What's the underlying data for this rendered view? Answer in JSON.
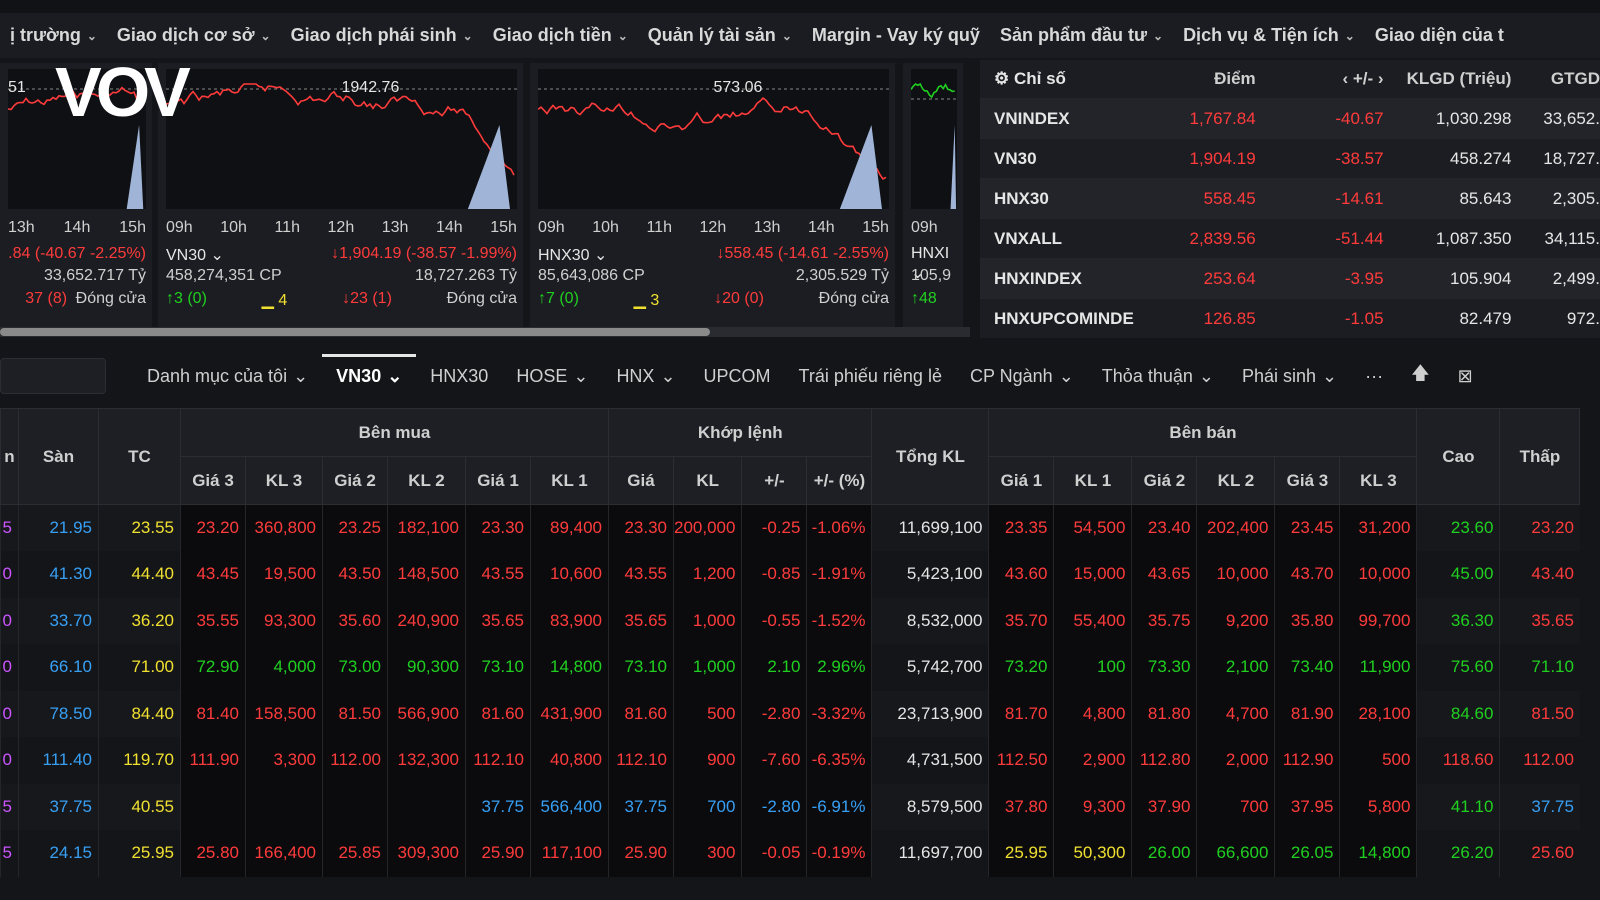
{
  "nav": [
    "ị trường",
    "Giao dịch cơ sở",
    "Giao dịch phái sinh",
    "Giao dịch tiền",
    "Quản lý tài sản",
    "Margin - Vay ký quỹ",
    "Sản phẩm đầu tư",
    "Dịch vụ & Tiện ích",
    "Giao diện của t"
  ],
  "logo": "VOV",
  "charts": [
    {
      "peak": "51",
      "times": [
        "13h",
        "14h",
        "15h"
      ],
      "name": "",
      "line1": ".84 (-40.67 -2.25%)",
      "vol": "",
      "val": "33,652.717 Tỷ",
      "up": "",
      "flat": "",
      "down": "37 (8)",
      "status": "Đóng cửa"
    },
    {
      "peak": "1942.76",
      "times": [
        "09h",
        "10h",
        "11h",
        "12h",
        "13h",
        "14h",
        "15h"
      ],
      "name": "VN30",
      "line1": "↓1,904.19 (-38.57 -1.99%)",
      "vol": "458,274,351 CP",
      "val": "18,727.263 Tỷ",
      "up": "↑3 (0)",
      "flat": "4",
      "down": "↓23 (1)",
      "status": "Đóng cửa"
    },
    {
      "peak": "573.06",
      "times": [
        "09h",
        "10h",
        "11h",
        "12h",
        "13h",
        "14h",
        "15h"
      ],
      "name": "HNX30",
      "line1": "↓558.45 (-14.61 -2.55%)",
      "vol": "85,643,086 CP",
      "val": "2,305.529 Tỷ",
      "up": "↑7 (0)",
      "flat": "3",
      "down": "↓20 (0)",
      "status": "Đóng cửa"
    },
    {
      "peak": "",
      "times": [
        "09h"
      ],
      "name": "HNXI",
      "line1": "",
      "vol": "105,9",
      "val": "",
      "up": "↑48",
      "flat": "",
      "down": "",
      "status": ""
    }
  ],
  "index_table": {
    "headers": [
      "Chỉ số",
      "Điểm",
      "‹ +/- ›",
      "KLGD (Triệu)",
      "GTGD"
    ],
    "rows": [
      [
        "VNINDEX",
        "1,767.84",
        "-40.67",
        "1,030.298",
        "33,652."
      ],
      [
        "VN30",
        "1,904.19",
        "-38.57",
        "458.274",
        "18,727."
      ],
      [
        "HNX30",
        "558.45",
        "-14.61",
        "85.643",
        "2,305."
      ],
      [
        "VNXALL",
        "2,839.56",
        "-51.44",
        "1,087.350",
        "34,115."
      ],
      [
        "HNXINDEX",
        "253.64",
        "-3.95",
        "105.904",
        "2,499."
      ],
      [
        "HNXUPCOMINDE",
        "126.85",
        "-1.05",
        "82.479",
        "972."
      ]
    ]
  },
  "tabs": [
    "Danh mục của tôi",
    "VN30",
    "HNX30",
    "HOSE",
    "HNX",
    "UPCOM",
    "Trái phiếu riêng lẻ",
    "CP Ngành",
    "Thỏa thuận",
    "Phái sinh",
    "···"
  ],
  "board": {
    "group_headers": {
      "buy": "Bên mua",
      "match": "Khớp lệnh",
      "sell": "Bên bán"
    },
    "headers": {
      "ceil": "n",
      "floor": "Sàn",
      "ref": "TC",
      "total": "Tổng KL",
      "high": "Cao",
      "low": "Thấp",
      "b3": "Giá 3",
      "kb3": "KL 3",
      "b2": "Giá 2",
      "kb2": "KL 2",
      "b1": "Giá 1",
      "kb1": "KL 1",
      "mp": "Giá",
      "mk": "KL",
      "ch": "+/-",
      "chp": "+/- (%)",
      "s1": "Giá 1",
      "ks1": "KL 1",
      "s2": "Giá 2",
      "ks2": "KL 2",
      "s3": "Giá 3",
      "ks3": "KL 3"
    },
    "rows": [
      [
        "5",
        "21.95",
        "23.55",
        "23.20",
        "360,800",
        "23.25",
        "182,100",
        "23.30",
        "89,400",
        "23.30",
        "200,000",
        "-0.25",
        "-1.06%",
        "11,699,100",
        "23.35",
        "54,500",
        "23.40",
        "202,400",
        "23.45",
        "31,200",
        "23.60",
        "23.20"
      ],
      [
        "0",
        "41.30",
        "44.40",
        "43.45",
        "19,500",
        "43.50",
        "148,500",
        "43.55",
        "10,600",
        "43.55",
        "1,200",
        "-0.85",
        "-1.91%",
        "5,423,100",
        "43.60",
        "15,000",
        "43.65",
        "10,000",
        "43.70",
        "10,000",
        "45.00",
        "43.40"
      ],
      [
        "0",
        "33.70",
        "36.20",
        "35.55",
        "93,300",
        "35.60",
        "240,900",
        "35.65",
        "83,900",
        "35.65",
        "1,000",
        "-0.55",
        "-1.52%",
        "8,532,000",
        "35.70",
        "55,400",
        "35.75",
        "9,200",
        "35.80",
        "99,700",
        "36.30",
        "35.65"
      ],
      [
        "0",
        "66.10",
        "71.00",
        "72.90",
        "4,000",
        "73.00",
        "90,300",
        "73.10",
        "14,800",
        "73.10",
        "1,000",
        "2.10",
        "2.96%",
        "5,742,700",
        "73.20",
        "100",
        "73.30",
        "2,100",
        "73.40",
        "11,900",
        "75.60",
        "71.10"
      ],
      [
        "0",
        "78.50",
        "84.40",
        "81.40",
        "158,500",
        "81.50",
        "566,900",
        "81.60",
        "431,900",
        "81.60",
        "500",
        "-2.80",
        "-3.32%",
        "23,713,900",
        "81.70",
        "4,800",
        "81.80",
        "4,700",
        "81.90",
        "28,100",
        "84.60",
        "81.50"
      ],
      [
        "0",
        "111.40",
        "119.70",
        "111.90",
        "3,300",
        "112.00",
        "132,300",
        "112.10",
        "40,800",
        "112.10",
        "900",
        "-7.60",
        "-6.35%",
        "4,731,500",
        "112.50",
        "2,900",
        "112.80",
        "2,000",
        "112.90",
        "500",
        "118.60",
        "112.00"
      ],
      [
        "5",
        "37.75",
        "40.55",
        "",
        "",
        "",
        "",
        "37.75",
        "566,400",
        "37.75",
        "700",
        "-2.80",
        "-6.91%",
        "8,579,500",
        "37.80",
        "9,300",
        "37.90",
        "700",
        "37.95",
        "5,800",
        "41.10",
        "37.75"
      ],
      [
        "5",
        "24.15",
        "25.95",
        "25.80",
        "166,400",
        "25.85",
        "309,300",
        "25.90",
        "117,100",
        "25.90",
        "300",
        "-0.05",
        "-0.19%",
        "11,697,700",
        "25.95",
        "50,300",
        "26.00",
        "66,600",
        "26.05",
        "14,800",
        "26.20",
        "25.60"
      ]
    ],
    "colors": [
      [
        "purple",
        "cyan",
        "yellow",
        "red",
        "red",
        "red",
        "red",
        "red",
        "red",
        "red",
        "red",
        "red",
        "red",
        "white",
        "red",
        "red",
        "red",
        "red",
        "red",
        "red",
        "green",
        "red"
      ],
      [
        "purple",
        "cyan",
        "yellow",
        "red",
        "red",
        "red",
        "red",
        "red",
        "red",
        "red",
        "red",
        "red",
        "red",
        "white",
        "red",
        "red",
        "red",
        "red",
        "red",
        "red",
        "green",
        "red"
      ],
      [
        "purple",
        "cyan",
        "yellow",
        "red",
        "red",
        "red",
        "red",
        "red",
        "red",
        "red",
        "red",
        "red",
        "red",
        "white",
        "red",
        "red",
        "red",
        "red",
        "red",
        "red",
        "green",
        "red"
      ],
      [
        "purple",
        "cyan",
        "yellow",
        "green",
        "green",
        "green",
        "green",
        "green",
        "green",
        "green",
        "green",
        "green",
        "green",
        "white",
        "green",
        "green",
        "green",
        "green",
        "green",
        "green",
        "green",
        "green"
      ],
      [
        "purple",
        "cyan",
        "yellow",
        "red",
        "red",
        "red",
        "red",
        "red",
        "red",
        "red",
        "red",
        "red",
        "red",
        "white",
        "red",
        "red",
        "red",
        "red",
        "red",
        "red",
        "green",
        "red"
      ],
      [
        "purple",
        "cyan",
        "yellow",
        "red",
        "red",
        "red",
        "red",
        "red",
        "red",
        "red",
        "red",
        "red",
        "red",
        "white",
        "red",
        "red",
        "red",
        "red",
        "red",
        "red",
        "red",
        "red"
      ],
      [
        "purple",
        "cyan",
        "yellow",
        "cyan",
        "cyan",
        "cyan",
        "cyan",
        "cyan",
        "cyan",
        "cyan",
        "cyan",
        "cyan",
        "cyan",
        "white",
        "red",
        "red",
        "red",
        "red",
        "red",
        "red",
        "green",
        "cyan"
      ],
      [
        "purple",
        "cyan",
        "yellow",
        "red",
        "red",
        "red",
        "red",
        "red",
        "red",
        "red",
        "red",
        "red",
        "red",
        "white",
        "yellow",
        "yellow",
        "green",
        "green",
        "green",
        "green",
        "green",
        "red"
      ]
    ]
  }
}
